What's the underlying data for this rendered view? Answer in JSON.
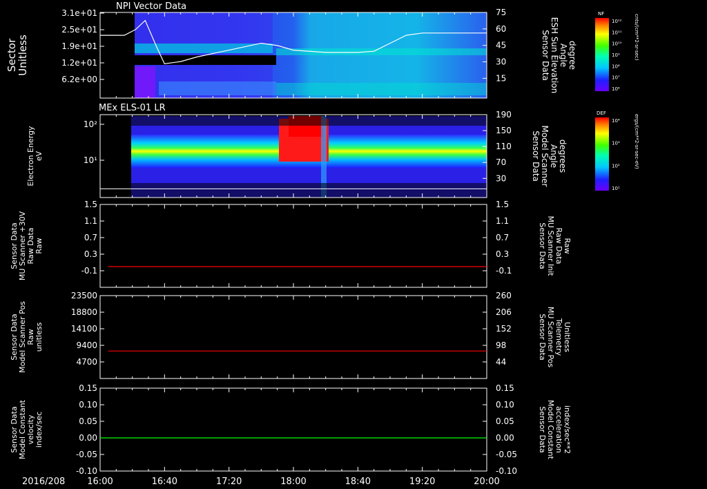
{
  "date_label": "2016/208",
  "time_ticks": [
    "16:00",
    "16:40",
    "17:20",
    "18:00",
    "18:40",
    "19:20",
    "20:00"
  ],
  "colors": {
    "axis": "#ffffff",
    "red_trace": "#ff0000",
    "green_trace": "#00ff00",
    "bg": "#000000"
  },
  "chart_data": [
    {
      "type": "heatmap",
      "title": "NPI Vector Data",
      "ylabel": [
        "Sector",
        "Unitless"
      ],
      "y_ticks": [
        "3.1e+01",
        "2.5e+01",
        "1.9e+01",
        "1.2e+01",
        "6.2e+00"
      ],
      "ylabel_right": [
        "Sensor Data",
        "ESH Sun Elevation",
        "Angle",
        "degree"
      ],
      "y_ticks_right": [
        "75",
        "60",
        "45",
        "30",
        "15"
      ],
      "ylim_right": [
        0,
        75
      ],
      "colorbar": {
        "label": "NF",
        "units": "cnts/(cm**2-sr-sec)",
        "ticks": [
          "10¹²",
          "10¹¹",
          "10¹⁰",
          "10⁹",
          "10⁸",
          "10⁷",
          "10⁶"
        ]
      },
      "overlay_line": {
        "name": "ESH Sun Elevation Angle",
        "x": [
          "16:00",
          "16:15",
          "16:22",
          "16:28",
          "16:35",
          "16:40",
          "16:50",
          "17:00",
          "17:20",
          "17:40",
          "17:50",
          "18:00",
          "18:20",
          "18:40",
          "18:50",
          "19:00",
          "19:10",
          "19:20",
          "19:40",
          "20:00"
        ],
        "y": [
          55,
          55,
          60,
          68,
          45,
          30,
          32,
          36,
          42,
          48,
          46,
          42,
          40,
          40,
          41,
          48,
          55,
          57,
          57,
          57
        ]
      }
    },
    {
      "type": "heatmap",
      "title": "MEx ELS-01 LR",
      "ylabel": [
        "Electron Energy",
        "eV"
      ],
      "y_ticks": [
        "10²",
        "10¹"
      ],
      "ylabel_right": [
        "Sensor Data",
        "Model Scanner",
        "Angle",
        "degrees"
      ],
      "y_ticks_right": [
        "190",
        "150",
        "110",
        "70",
        "30"
      ],
      "ylim_right": [
        0,
        190
      ],
      "colorbar": {
        "label": "DEF",
        "units": "ergs/(cm**2-sr-sec-eV)",
        "ticks": [
          "10⁴",
          "10³",
          "10²",
          "10¹"
        ]
      },
      "overlay_line": {
        "name": "Model Scanner Angle",
        "x": [
          "16:00",
          "20:00"
        ],
        "y": [
          20,
          20
        ]
      }
    },
    {
      "type": "line",
      "ylabel": [
        "Sensor Data",
        "MU Scanner +30V",
        "Raw Data",
        "Raw"
      ],
      "y_ticks": [
        "1.5",
        "1.1",
        "0.7",
        "0.3",
        "-0.1"
      ],
      "ylim": [
        -0.5,
        1.5
      ],
      "ylabel_right": [
        "Sensor Data",
        "MU Scanner Init",
        "Raw Data",
        "Raw"
      ],
      "y_ticks_right": [
        "1.5",
        "1.1",
        "0.7",
        "0.3",
        "-0.1"
      ],
      "series": [
        {
          "x": [
            "16:05",
            "20:00"
          ],
          "y": [
            -0.0,
            -0.0
          ]
        }
      ]
    },
    {
      "type": "line",
      "ylabel": [
        "Sensor Data",
        "Model Scanner Pos",
        "Raw",
        "unitless"
      ],
      "y_ticks": [
        "23500",
        "18800",
        "14100",
        "9400",
        "4700"
      ],
      "ylim": [
        0,
        23500
      ],
      "ylabel_right": [
        "Sensor Data",
        "MU Scanner Pos",
        "Telemetry",
        "Unitless"
      ],
      "y_ticks_right": [
        "260",
        "206",
        "152",
        "98",
        "44"
      ],
      "series": [
        {
          "x": [
            "16:05",
            "20:00"
          ],
          "y": [
            7800,
            7800
          ]
        }
      ]
    },
    {
      "type": "line",
      "ylabel": [
        "Sensor Data",
        "Model Constant",
        "velocity",
        "index/sec"
      ],
      "y_ticks": [
        "0.15",
        "0.10",
        "0.05",
        "0.00",
        "-0.05",
        "-0.10"
      ],
      "ylim": [
        -0.1,
        0.15
      ],
      "ylabel_right": [
        "Sensor Data",
        "Model Constant",
        "acceleration",
        "index/sec**2"
      ],
      "y_ticks_right": [
        "0.15",
        "0.10",
        "0.05",
        "0.00",
        "-0.05",
        "-0.10"
      ],
      "series": [
        {
          "x": [
            "16:00",
            "20:00"
          ],
          "y": [
            0.0,
            0.0
          ]
        }
      ]
    }
  ]
}
